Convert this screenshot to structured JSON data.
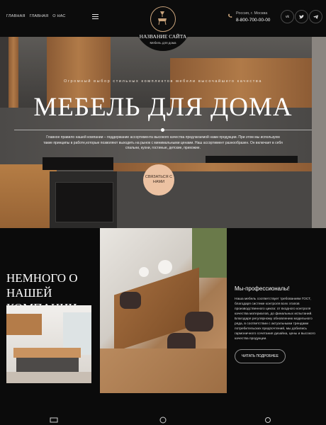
{
  "header": {
    "nav": [
      "ГЛАВНАЯ",
      "ГЛАВНАЯ",
      "О НАС"
    ],
    "site_title": "НАЗВАНИЕ САЙТА",
    "site_subtitle": "Мебель для дома",
    "city": "Россия, г. Москва",
    "phone": "8-800-700-00-00",
    "social_icons": [
      "vk-icon",
      "twitter-icon",
      "telegram-icon"
    ]
  },
  "hero": {
    "supertitle": "Огромный выбор стильных комплектов мебели высочайшего качества",
    "title": "МЕБЕЛЬ ДЛЯ ДОМА",
    "description": "Главное правило нашей компании – поддержание ассортимента высокого качества предлагаемой нами продукции. При этом мы используем такие принципы в работе,которые позволяют выходить на рынок с минимальными ценами. Наш ассортимент разнообразен. Он включает в себя спальни, кухни, гостиные, детские, прихожие.",
    "cta_label": "СВЯЗАТЬСЯ С НАМИ"
  },
  "about": {
    "title": "НЕМНОГО О НАШЕЙ КОМПАНИИ",
    "pro_title": "Мы-профессионалы!",
    "pro_text": "Наша мебель соответствует требованиям ГОСТ, благодаря системе контроля всех этапов производственного цикла: от входного контроля качества материалов, до финальных испытаний. Благодаря регулярному обновлению модельного ряда, в соответствии с актуальными трендами потребительских предпочтений, мы добились гармоничного сочетания дизайна, цены и высокого качества продукции.",
    "more_label": "ЧИТАТЬ ПОДРОБНЕЕ"
  },
  "colors": {
    "accent": "#ecc2a2",
    "gold": "#c9a37b",
    "background": "#0b0b0b"
  }
}
